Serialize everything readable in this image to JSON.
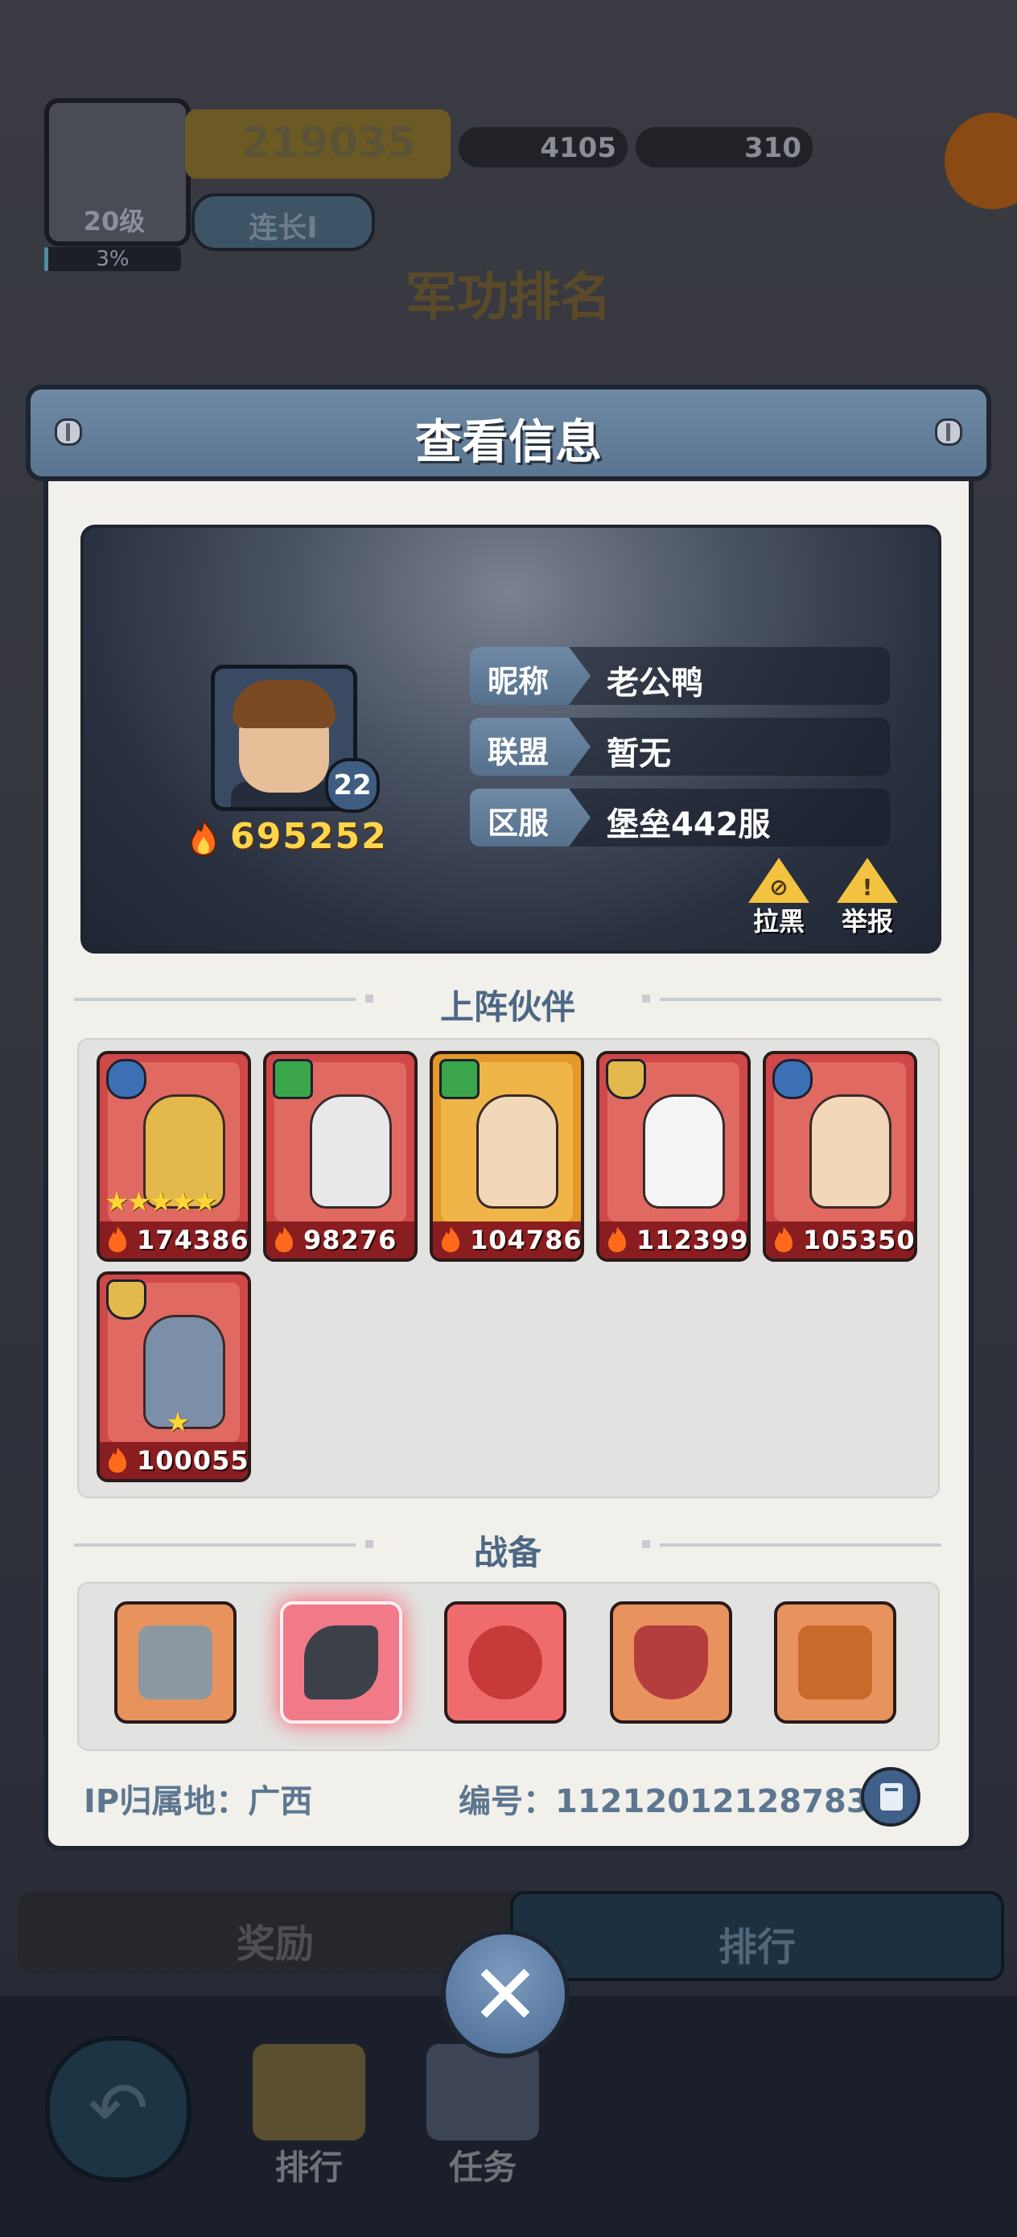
{
  "background": {
    "level": "20级",
    "exp_progress": "3%",
    "exp_fraction": 0.03,
    "power": "219035",
    "gems": "4105",
    "cash": "310",
    "rank_title": "连长I",
    "screen_title": "军功排名",
    "tabs": [
      "奖励",
      "排行"
    ],
    "nav": [
      "排行",
      "任务"
    ]
  },
  "dialog": {
    "title": "查看信息",
    "player": {
      "level": "22",
      "power": "695252",
      "fields": [
        {
          "label": "昵称",
          "value": "老公鸭"
        },
        {
          "label": "联盟",
          "value": "暂无"
        },
        {
          "label": "区服",
          "value": "堡垒442服"
        }
      ],
      "actions": [
        {
          "label": "拉黑",
          "icon": "block-icon"
        },
        {
          "label": "举报",
          "icon": "warning-icon"
        }
      ]
    },
    "partners_title": "上阵伙伴",
    "partners": [
      {
        "power": "174386",
        "stars": "★★★★★",
        "role": "crosshair"
      },
      {
        "power": "98276",
        "stars": "",
        "role": "clover"
      },
      {
        "power": "104786",
        "stars": "",
        "role": "clover"
      },
      {
        "power": "112399",
        "stars": "",
        "role": "shield"
      },
      {
        "power": "105350",
        "stars": "",
        "role": "crosshair"
      },
      {
        "power": "100055",
        "stars": "★",
        "role": "shield"
      }
    ],
    "equipment_title": "战备",
    "equipment": [
      "turret-icon",
      "batmobile-icon",
      "fire-creature-icon",
      "armor-icon",
      "gear-book-icon"
    ],
    "ip_location": "IP归属地：广西",
    "id_number": "编号：11212012128783"
  },
  "colors": {
    "accent_blue": "#4d6885",
    "power_gold": "#ffd64a",
    "card_red": "#d04848"
  }
}
